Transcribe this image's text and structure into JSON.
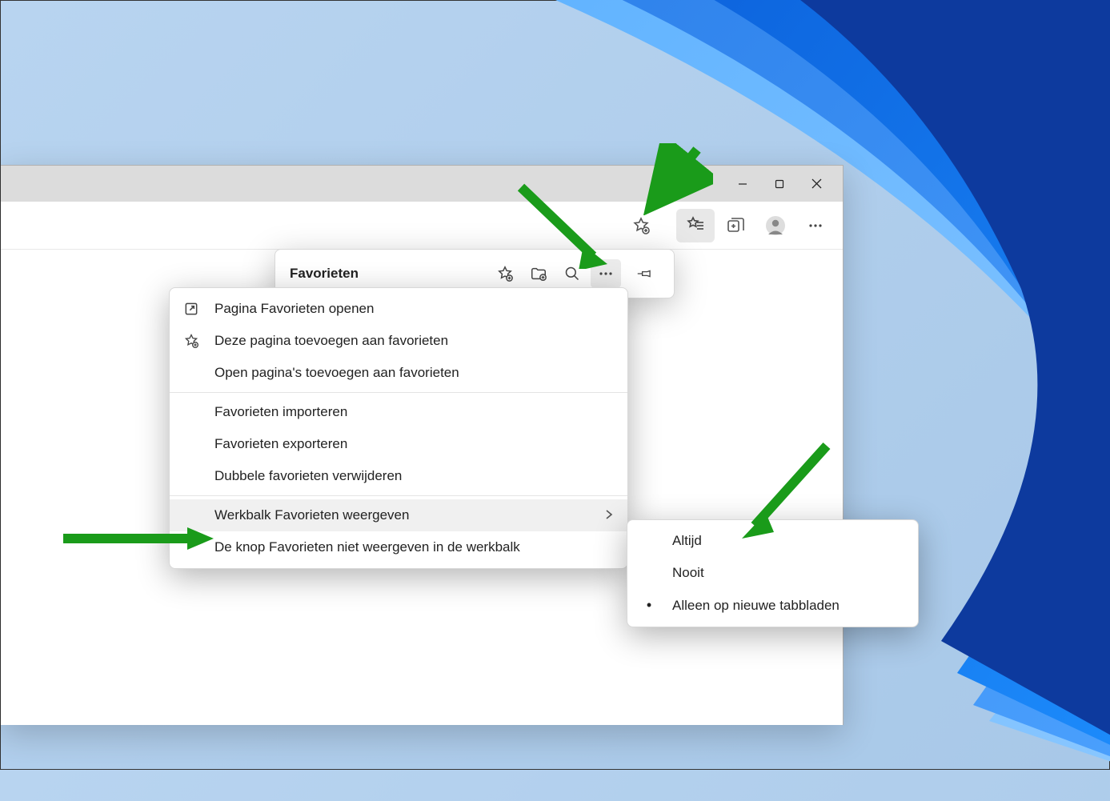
{
  "favorites_panel": {
    "title": "Favorieten"
  },
  "context_menu": {
    "items": [
      {
        "icon": "open-external",
        "label": "Pagina Favorieten openen"
      },
      {
        "icon": "star-add",
        "label": "Deze pagina toevoegen aan favorieten"
      },
      {
        "icon": "",
        "label": "Open pagina's toevoegen aan favorieten"
      },
      {
        "sep": true
      },
      {
        "icon": "",
        "label": "Favorieten importeren"
      },
      {
        "icon": "",
        "label": "Favorieten exporteren"
      },
      {
        "icon": "",
        "label": "Dubbele favorieten verwijderen"
      },
      {
        "sep": true
      },
      {
        "icon": "",
        "label": "Werkbalk Favorieten weergeven",
        "submenu": true,
        "hover": true
      },
      {
        "icon": "",
        "label": "De knop Favorieten niet weergeven in de werkbalk"
      }
    ]
  },
  "submenu": {
    "items": [
      {
        "label": "Altijd",
        "selected": false
      },
      {
        "label": "Nooit",
        "selected": false
      },
      {
        "label": "Alleen op nieuwe tabbladen",
        "selected": true
      }
    ]
  },
  "colors": {
    "accent_arrow": "#1a9b1a"
  }
}
